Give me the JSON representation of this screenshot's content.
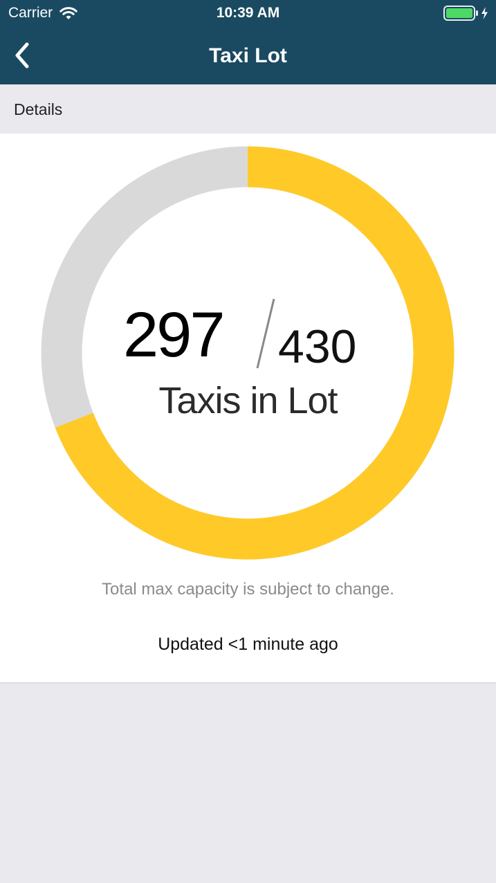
{
  "status_bar": {
    "carrier": "Carrier",
    "time": "10:39 AM",
    "wifi_icon": "wifi-icon",
    "battery_icon": "battery-charging-icon"
  },
  "nav": {
    "title": "Taxi Lot",
    "back_icon": "chevron-left-icon"
  },
  "section": {
    "label": "Details"
  },
  "lot": {
    "current": "297",
    "total": "430",
    "caption": "Taxis in Lot",
    "fill_fraction": 0.691
  },
  "note": "Total max capacity is subject to change.",
  "updated": "Updated <1 minute ago",
  "colors": {
    "header": "#1a4a62",
    "ring_fill": "#ffca28",
    "ring_track": "#d9d9d9",
    "background": "#e9e9ee",
    "battery": "#4cd964"
  }
}
